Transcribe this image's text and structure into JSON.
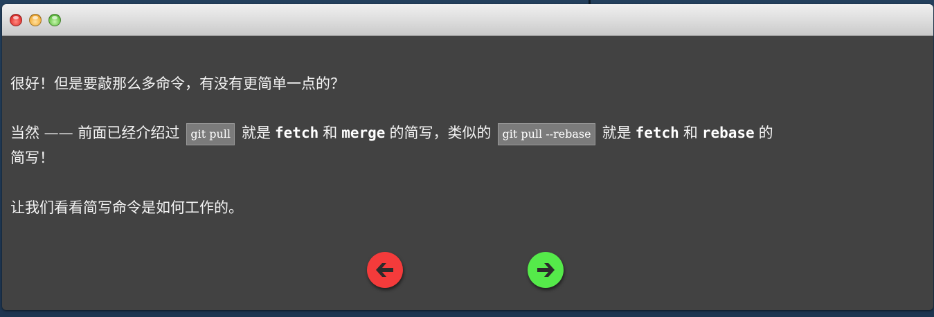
{
  "dialog": {
    "paragraph_1": "很好！但是要敲那么多命令，有没有更简单一点的？",
    "paragraph_2": {
      "part_1": "当然 —— 前面已经介绍过",
      "code_1": "git pull",
      "part_2": "就是",
      "kw_1": "fetch",
      "part_3": "和",
      "kw_2": "merge",
      "part_4": "的简写，类似的",
      "code_2": "git pull --rebase",
      "part_5": "就是",
      "kw_3": "fetch",
      "part_6": "和",
      "kw_4": "rebase",
      "part_7": "的",
      "part_8": "简写！"
    },
    "paragraph_3": "让我们看看简写命令是如何工作的。"
  },
  "navigation": {
    "prev_icon": "arrow-left-circle-icon",
    "next_icon": "arrow-right-circle-icon",
    "prev_color": "#f43b3b",
    "next_color": "#55ea4a"
  },
  "colors": {
    "window_background": "#424242",
    "code_background": "#7b7b7b"
  }
}
